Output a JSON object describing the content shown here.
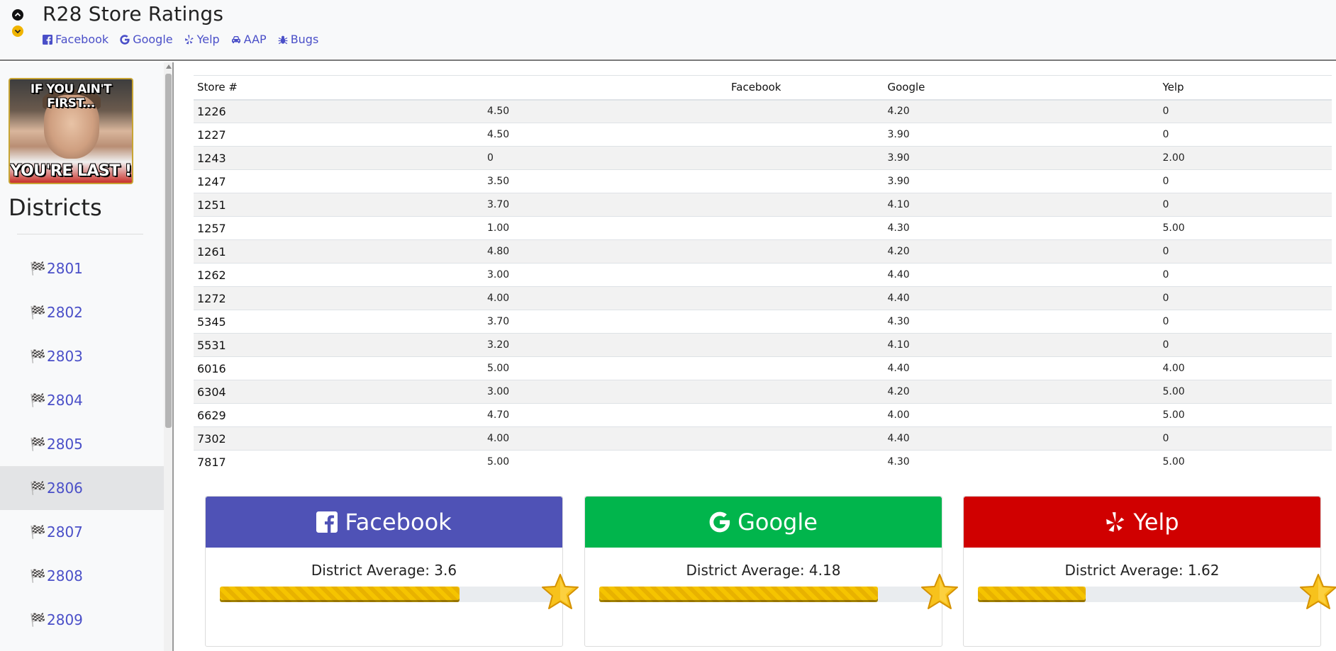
{
  "header": {
    "title": "R28 Store Ratings",
    "links": [
      {
        "label": "Facebook",
        "icon": "facebook-icon"
      },
      {
        "label": "Google",
        "icon": "google-icon"
      },
      {
        "label": "Yelp",
        "icon": "yelp-icon"
      },
      {
        "label": "AAP",
        "icon": "car-icon"
      },
      {
        "label": "Bugs",
        "icon": "bug-icon"
      }
    ]
  },
  "sidebar": {
    "meme": {
      "top_text": "IF YOU AIN'T FIRST...",
      "bottom_text": "YOU'RE LAST !"
    },
    "title": "Districts",
    "items": [
      {
        "label": "2801"
      },
      {
        "label": "2802"
      },
      {
        "label": "2803"
      },
      {
        "label": "2804"
      },
      {
        "label": "2805"
      },
      {
        "label": "2806"
      },
      {
        "label": "2807"
      },
      {
        "label": "2808"
      },
      {
        "label": "2809"
      }
    ],
    "active_district": "2806"
  },
  "table": {
    "headers": [
      "Store #",
      "Facebook",
      "Google",
      "Yelp"
    ],
    "rows": [
      [
        "1226",
        "4.50",
        "4.20",
        "0"
      ],
      [
        "1227",
        "4.50",
        "3.90",
        "0"
      ],
      [
        "1243",
        "0",
        "3.90",
        "2.00"
      ],
      [
        "1247",
        "3.50",
        "3.90",
        "0"
      ],
      [
        "1251",
        "3.70",
        "4.10",
        "0"
      ],
      [
        "1257",
        "1.00",
        "4.30",
        "5.00"
      ],
      [
        "1261",
        "4.80",
        "4.20",
        "0"
      ],
      [
        "1262",
        "3.00",
        "4.40",
        "0"
      ],
      [
        "1272",
        "4.00",
        "4.40",
        "0"
      ],
      [
        "5345",
        "3.70",
        "4.30",
        "0"
      ],
      [
        "5531",
        "3.20",
        "4.10",
        "0"
      ],
      [
        "6016",
        "5.00",
        "4.40",
        "4.00"
      ],
      [
        "6304",
        "3.00",
        "4.20",
        "5.00"
      ],
      [
        "6629",
        "4.70",
        "4.00",
        "5.00"
      ],
      [
        "7302",
        "4.00",
        "4.40",
        "0"
      ],
      [
        "7817",
        "5.00",
        "4.30",
        "5.00"
      ]
    ]
  },
  "cards": {
    "facebook": {
      "title": "Facebook",
      "avg_text": "District Average: 3.6",
      "progress_fraction": 0.72,
      "color": "#4f52b6"
    },
    "google": {
      "title": "Google",
      "avg_text": "District Average: 4.18",
      "progress_fraction": 0.836,
      "color": "#01b54c"
    },
    "yelp": {
      "title": "Yelp",
      "avg_text": "District Average: 1.62",
      "progress_fraction": 0.324,
      "color": "#d00000"
    }
  }
}
